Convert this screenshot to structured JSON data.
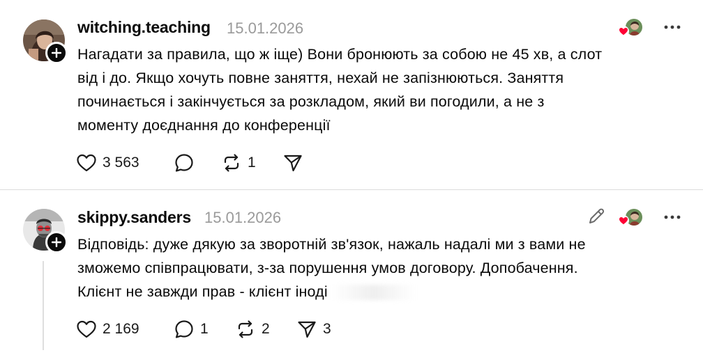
{
  "posts": [
    {
      "username": "witching.teaching",
      "date": "15.01.2026",
      "text_lines": [
        "Нагадати за правила, що ж іще) Вони бронюють за собою не 45 хв, а слот",
        "від і до. Якщо хочуть повне заняття, нехай не запізнюються. Заняття",
        "починається і закінчується за розкладом, який ви погодили, а не з",
        "моменту доєднання до конференції"
      ],
      "likes": "3 563",
      "replies": "",
      "reposts": "1",
      "shares": ""
    },
    {
      "username": "skippy.sanders",
      "date": "15.01.2026",
      "text_lines": [
        "Відповідь: дуже дякую за зворотній зв'язок, нажаль надалі ми з вами не",
        "зможемо співпрацювати, з-за порушення умов договору. Допобачення.",
        "Клієнт не завжди прав - клієнт іноді"
      ],
      "likes": "2 169",
      "replies": "1",
      "reposts": "2",
      "shares": "3"
    }
  ],
  "icons": {
    "like": "heart-outline-icon",
    "reply": "speech-bubble-icon",
    "repost": "repost-arrows-icon",
    "share": "send-paper-plane-icon",
    "more": "more-horizontal-icon",
    "edit": "pencil-icon",
    "follow": "plus-icon",
    "liked_by": "red-heart-icon"
  },
  "colors": {
    "text": "#0a0a0a",
    "muted": "#9a9a9a",
    "like_red": "#ff0034",
    "divider": "#dcdcdc"
  }
}
